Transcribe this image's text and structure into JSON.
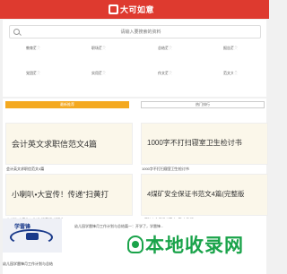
{
  "header": {
    "logo_text": "大可如意",
    "bg_color": "#de3a2f"
  },
  "search": {
    "placeholder": "请输入要搜索的资料"
  },
  "categories": [
    {
      "label": "教育范文",
      "color": "#3f8ee8",
      "icon": "document-icon"
    },
    {
      "label": "职场范文",
      "color": "#f4a920",
      "icon": "briefcase-icon"
    },
    {
      "label": "总结范文",
      "color": "#8b6ad6",
      "icon": "summary-icon"
    },
    {
      "label": "报告范文",
      "color": "#43b658",
      "icon": "report-icon"
    },
    {
      "label": "党团范文",
      "color": "#3f8ee8",
      "icon": "flag-icon"
    },
    {
      "label": "实用范文",
      "color": "#f4a920",
      "icon": "tools-icon"
    },
    {
      "label": "作文范文",
      "color": "#8b6ad6",
      "icon": "pen-icon"
    },
    {
      "label": "范文大全",
      "color": "#43b658",
      "icon": "book-icon"
    }
  ],
  "tabs": {
    "active": "最新推荐",
    "inactive": "热门排行"
  },
  "articles": [
    {
      "thumb_title": "会计英文求职信范文4篇",
      "caption": "会计英文求职信范文4篇"
    },
    {
      "thumb_title": "1000字不打扫寝室卫生检讨书",
      "caption": "1000字不打扫寝室卫生检讨书"
    },
    {
      "thumb_title": "小喇叭•大宣传！传递\"扫黄打",
      "caption": "小喇叭•大宣传！传递\"扫黄打\"新理念"
    },
    {
      "thumb_title": "4煤矿安全保证书范文4篇(完整版",
      "caption": "4煤矿安全保证书范文4篇(完整版)"
    }
  ],
  "bottom": {
    "thumb_text": "学雷锋",
    "caption": "幼儿园学雷锋月工作计划与总结",
    "text": "幼儿园学雷锋月工作计划与总结篇一：开学了，学雷锋..."
  },
  "watermark": {
    "text": "本地收录网"
  }
}
